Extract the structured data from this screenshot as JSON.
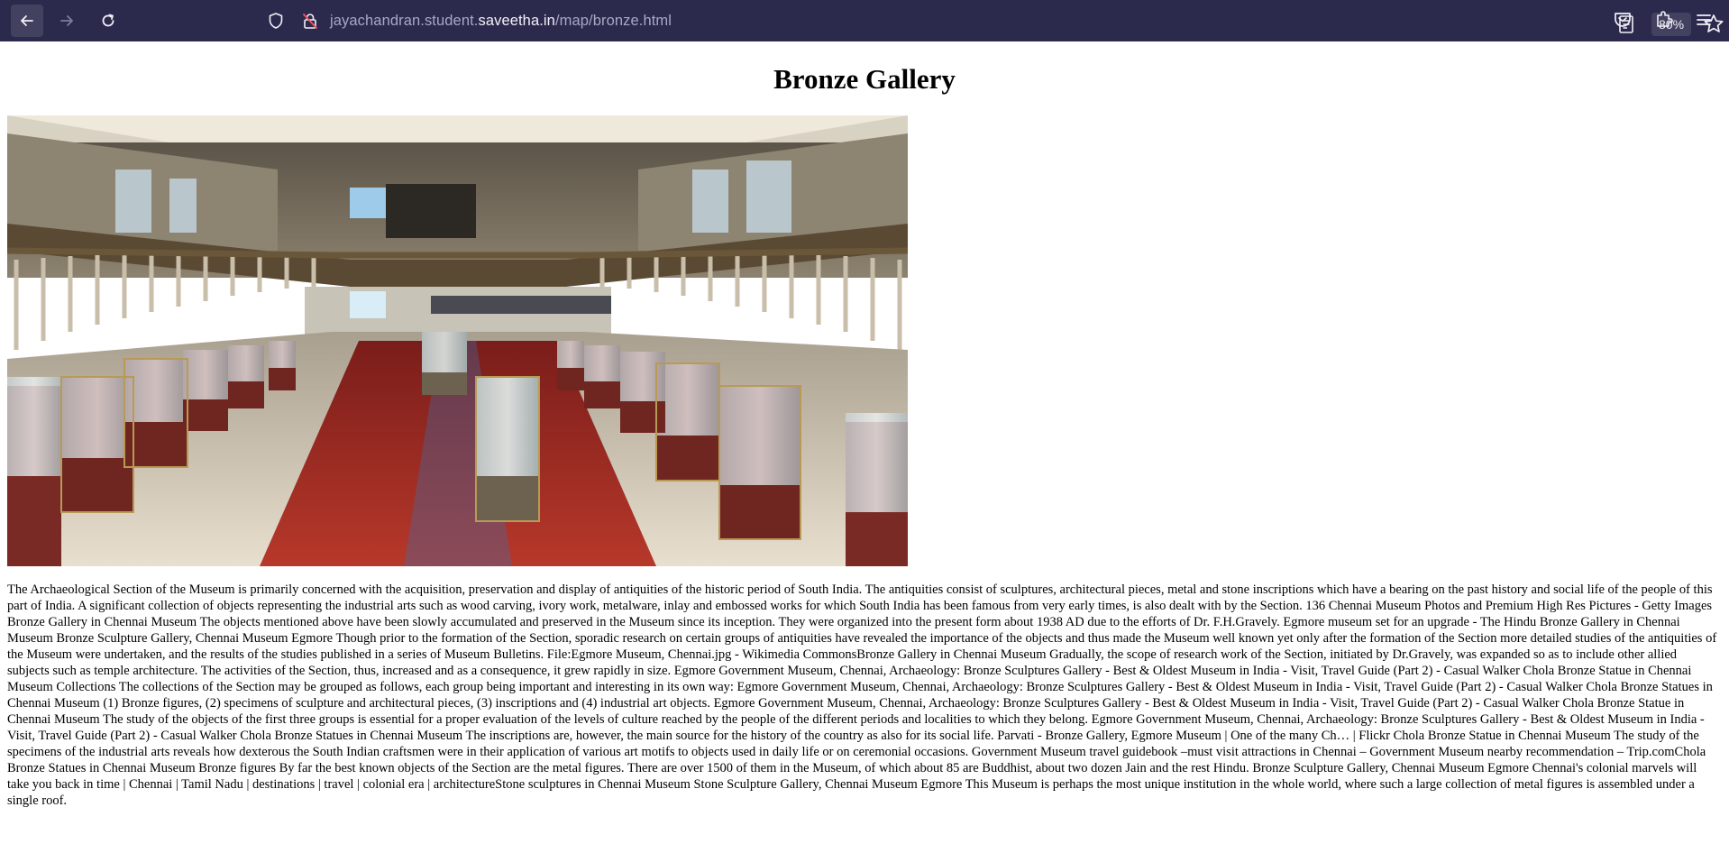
{
  "browser": {
    "url_prefix": "jayachandran.student.",
    "url_host": "saveetha.in",
    "url_path": "/map/bronze.html",
    "zoom": "80%",
    "theme_color": "#2b2a4c"
  },
  "page": {
    "title": "Bronze Gallery",
    "image_alt": "Bronze Gallery",
    "body": "The Archaeological Section of the Museum is primarily concerned with the acquisition, preservation and display of antiquities of the historic period of South India. The antiquities consist of sculptures, architectural pieces, metal and stone inscriptions which have a bearing on the past history and social life of the people of this part of India. A significant collection of objects representing the industrial arts such as wood carving, ivory work, metalware, inlay and embossed works for which South India has been famous from very early times, is also dealt with by the Section. 136 Chennai Museum Photos and Premium High Res Pictures - Getty Images Bronze Gallery in Chennai Museum The objects mentioned above have been slowly accumulated and preserved in the Museum since its inception. They were organized into the present form about 1938 AD due to the efforts of Dr. F.H.Gravely. Egmore museum set for an upgrade - The Hindu Bronze Gallery in Chennai Museum Bronze Sculpture Gallery, Chennai Museum Egmore Though prior to the formation of the Section, sporadic research on certain groups of antiquities have revealed the importance of the objects and thus made the Museum well known yet only after the formation of the Section more detailed studies of the antiquities of the Museum were undertaken, and the results of the studies published in a series of Museum Bulletins. File:Egmore Museum, Chennai.jpg - Wikimedia CommonsBronze Gallery in Chennai Museum Gradually, the scope of research work of the Section, initiated by Dr.Gravely, was expanded so as to include other allied subjects such as temple architecture. The activities of the Section, thus, increased and as a consequence, it grew rapidly in size. Egmore Government Museum, Chennai, Archaeology: Bronze Sculptures Gallery - Best & Oldest Museum in India - Visit, Travel Guide (Part 2) - Casual Walker Chola Bronze Statue in Chennai Museum Collections The collections of the Section may be grouped as follows, each group being important and interesting in its own way: Egmore Government Museum, Chennai, Archaeology: Bronze Sculptures Gallery - Best & Oldest Museum in India - Visit, Travel Guide (Part 2) - Casual Walker Chola Bronze Statues in Chennai Museum (1) Bronze figures, (2) specimens of sculpture and architectural pieces, (3) inscriptions and (4) industrial art objects. Egmore Government Museum, Chennai, Archaeology: Bronze Sculptures Gallery - Best & Oldest Museum in India - Visit, Travel Guide (Part 2) - Casual Walker Chola Bronze Statue in Chennai Museum The study of the objects of the first three groups is essential for a proper evaluation of the levels of culture reached by the people of the different periods and localities to which they belong. Egmore Government Museum, Chennai, Archaeology: Bronze Sculptures Gallery - Best & Oldest Museum in India - Visit, Travel Guide (Part 2) - Casual Walker Chola Bronze Statues in Chennai Museum The inscriptions are, however, the main source for the history of the country as also for its social life. Parvati - Bronze Gallery, Egmore Museum | One of the many Ch… | Flickr Chola Bronze Statue in Chennai Museum The study of the specimens of the industrial arts reveals how dexterous the South Indian craftsmen were in their application of various art motifs to objects used in daily life or on ceremonial occasions. Government Museum travel guidebook –must visit attractions in Chennai – Government Museum nearby recommendation – Trip.comChola Bronze Statues in Chennai Museum Bronze figures By far the best known objects of the Section are the metal figures. There are over 1500 of them in the Museum, of which about 85 are Buddhist, about two dozen Jain and the rest Hindu. Bronze Sculpture Gallery, Chennai Museum Egmore Chennai's colonial marvels will take you back in time | Chennai | Tamil Nadu | destinations | travel | colonial era | architectureStone sculptures in Chennai Museum Stone Sculpture Gallery, Chennai Museum Egmore This Museum is perhaps the most unique institution in the whole world, where such a large collection of metal figures is assembled under a single roof."
  },
  "icons": {
    "back": "arrow-left-icon",
    "forward": "arrow-right-icon",
    "reload": "reload-icon",
    "tracking": "shield-icon",
    "lock": "lock-icon",
    "reader": "reader-view-icon",
    "bookmark": "star-icon",
    "pocket": "pocket-icon",
    "extensions": "puzzle-icon",
    "menu": "hamburger-menu-icon"
  }
}
